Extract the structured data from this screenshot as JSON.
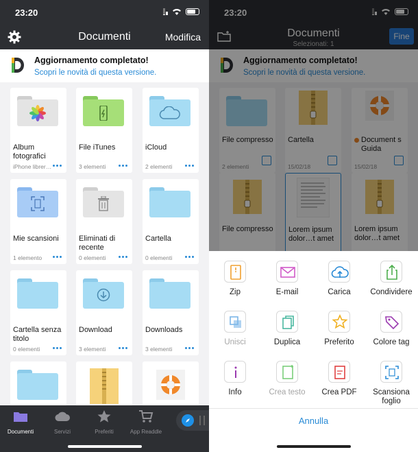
{
  "left": {
    "status_time": "23:20",
    "nav_title": "Documenti",
    "edit_label": "Modifica",
    "banner_title": "Aggiornamento completato!",
    "banner_link": "Scopri le novità di questa versione.",
    "items": [
      {
        "name": "Album fotografici",
        "meta": "iPhone librer…",
        "icon": "photos-folder-icon"
      },
      {
        "name": "File iTunes",
        "meta": "3 elementi",
        "icon": "itunes-folder-icon"
      },
      {
        "name": "iCloud",
        "meta": "2 elementi",
        "icon": "icloud-folder-icon"
      },
      {
        "name": "Mie scansioni",
        "meta": "1 elemento",
        "icon": "scan-folder-icon"
      },
      {
        "name": "Eliminati di recente",
        "meta": "0 elementi",
        "icon": "trash-folder-icon"
      },
      {
        "name": "Cartella",
        "meta": "0 elementi",
        "icon": "folder-icon"
      },
      {
        "name": "Cartella senza titolo",
        "meta": "0 elementi",
        "icon": "folder-icon"
      },
      {
        "name": "Download",
        "meta": "3 elementi",
        "icon": "download-folder-icon"
      },
      {
        "name": "Downloads",
        "meta": "3 elementi",
        "icon": "folder-icon"
      },
      {
        "name": "",
        "meta": "",
        "icon": "folder-icon"
      },
      {
        "name": "",
        "meta": "",
        "icon": "zip-icon"
      },
      {
        "name": "",
        "meta": "",
        "icon": "lifebuoy-icon"
      }
    ],
    "tabs": [
      "Documenti",
      "Servizi",
      "Preferiti",
      "App Readdle"
    ]
  },
  "right": {
    "status_time": "23:20",
    "nav_title": "Documenti",
    "nav_subtitle": "Selezionati: 1",
    "done_label": "Fine",
    "banner_title": "Aggiornamento completato!",
    "banner_link": "Scopri le novità di questa versione.",
    "items": [
      {
        "name": "File compresso",
        "meta": "2 elementi"
      },
      {
        "name": "Cartella",
        "meta": "15/02/18"
      },
      {
        "name": "Document s Guida",
        "meta": "15/02/18"
      },
      {
        "name": "File compresso",
        "meta": ""
      },
      {
        "name": "Lorem ipsum dolor…t amet",
        "meta": ""
      },
      {
        "name": "Lorem ipsum dolor…t amet",
        "meta": ""
      }
    ],
    "actions": [
      {
        "label": "Zip",
        "icon": "zip-icon",
        "color": "#f0a030",
        "disabled": false
      },
      {
        "label": "E-mail",
        "icon": "mail-icon",
        "color": "#d05ac8",
        "disabled": false
      },
      {
        "label": "Carica",
        "icon": "upload-cloud-icon",
        "color": "#2a8bd6",
        "disabled": false
      },
      {
        "label": "Condividere",
        "icon": "share-icon",
        "color": "#4cae4c",
        "disabled": false
      },
      {
        "label": "Unisci",
        "icon": "merge-icon",
        "color": "#7bb6e8",
        "disabled": true
      },
      {
        "label": "Duplica",
        "icon": "duplicate-icon",
        "color": "#4ab8a0",
        "disabled": false
      },
      {
        "label": "Preferito",
        "icon": "star-icon",
        "color": "#f0b020",
        "disabled": false
      },
      {
        "label": "Colore tag",
        "icon": "tag-icon",
        "color": "#9b3ab0",
        "disabled": false
      },
      {
        "label": "Info",
        "icon": "info-icon",
        "color": "#9b3ab0",
        "disabled": false
      },
      {
        "label": "Crea testo",
        "icon": "create-text-icon",
        "color": "#7bcf7b",
        "disabled": true
      },
      {
        "label": "Crea PDF",
        "icon": "create-pdf-icon",
        "color": "#e04040",
        "disabled": false
      },
      {
        "label": "Scansiona foglio",
        "icon": "scan-icon",
        "color": "#2a8bd6",
        "disabled": false
      }
    ],
    "cancel_label": "Annulla"
  }
}
